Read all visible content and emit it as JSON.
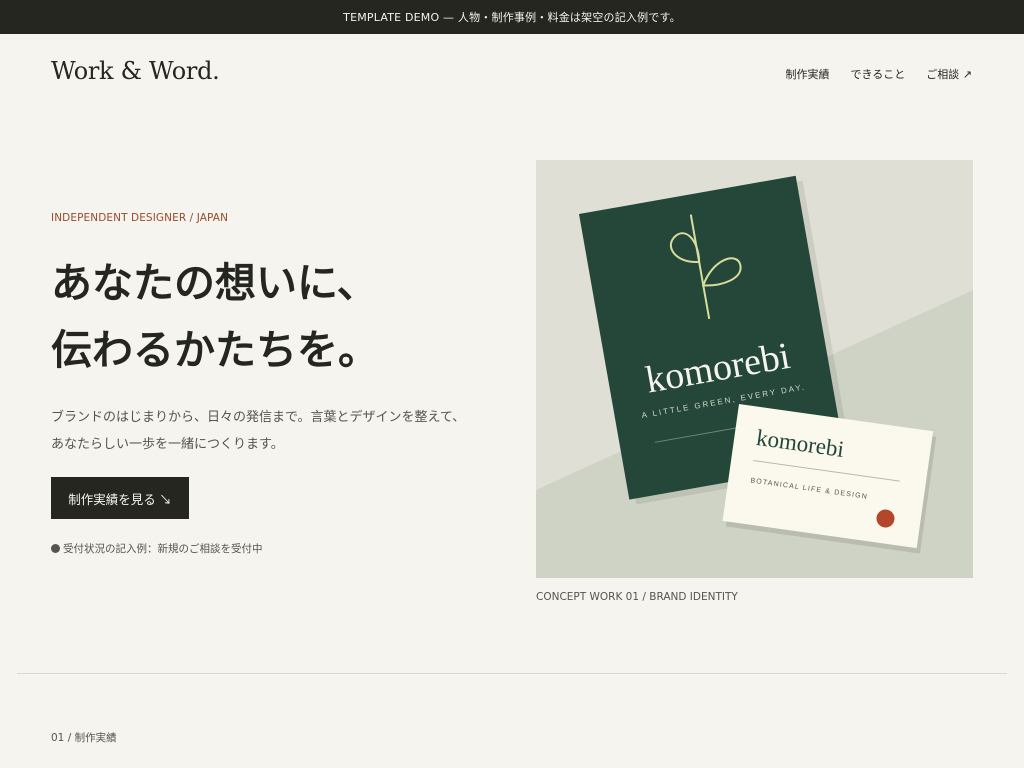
{
  "banner": {
    "text": "TEMPLATE DEMO — 人物・制作事例・料金は架空の記入例です。"
  },
  "header": {
    "logo": "Work & Word.",
    "nav": [
      {
        "label": "制作実績"
      },
      {
        "label": "できること"
      },
      {
        "label": "ご相談 ↗"
      }
    ]
  },
  "hero": {
    "eyebrow": "INDEPENDENT DESIGNER / JAPAN",
    "headline_line1": "あなたの想いに、",
    "headline_line2": "伝わるかたちを。",
    "lead_line1": "ブランドのはじまりから、日々の発信まで。言葉とデザインを整えて、",
    "lead_line2": "あなたらしい一歩を一緒につくります。",
    "cta_label": "制作実績を見る ↘",
    "status_text": "受付状況の記入例：新規のご相談を受付中"
  },
  "showcase": {
    "book_title": "komorebi",
    "book_tagline": "A LITTLE GREEN, EVERY DAY.",
    "card_title": "komorebi",
    "card_tagline": "BOTANICAL LIFE & DESIGN",
    "caption": "CONCEPT WORK 01 / BRAND IDENTITY",
    "colors": {
      "book": "#24473a",
      "card": "#fbf9ee",
      "seal": "#b2472b",
      "leaf": "#d8dc9c",
      "bg_top": "#dfdfd5",
      "bg_bottom": "#cfd3c5"
    }
  },
  "section": {
    "label": "01 / 制作実績"
  }
}
